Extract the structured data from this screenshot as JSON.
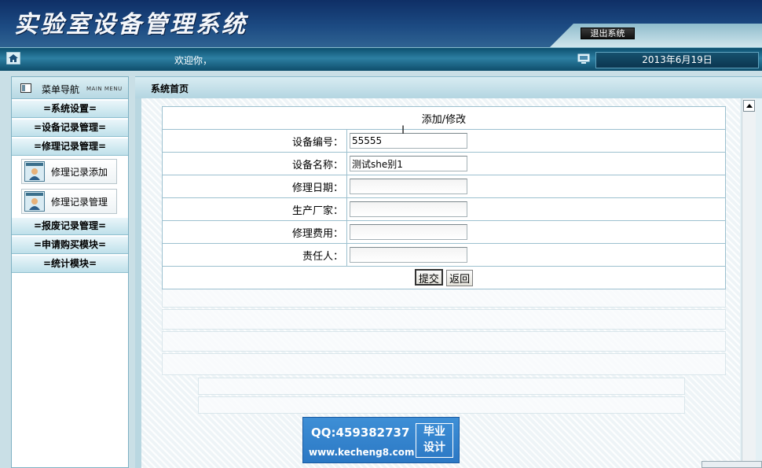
{
  "header": {
    "app_title": "实验室设备管理系统",
    "logout_label": "退出系统"
  },
  "topbar": {
    "welcome": "欢迎你，",
    "date": "2013年6月19日"
  },
  "menu": {
    "title": "菜单导航",
    "title_en": "MAIN MENU",
    "groups": [
      "=系统设置=",
      "=设备记录管理=",
      "=修理记录管理=",
      "=报废记录管理=",
      "=申请购买模块=",
      "=统计模块="
    ],
    "sub_items": [
      "修理记录添加",
      "修理记录管理"
    ]
  },
  "content": {
    "breadcrumb": "系统首页"
  },
  "form": {
    "title": "添加/修改",
    "fields": [
      {
        "label": "设备编号：",
        "value": "55555"
      },
      {
        "label": "设备名称：",
        "value": "测试she别1"
      },
      {
        "label": "修理日期：",
        "value": ""
      },
      {
        "label": "生产厂家：",
        "value": ""
      },
      {
        "label": "修理费用：",
        "value": ""
      },
      {
        "label": "责任人：",
        "value": ""
      }
    ],
    "submit_label": "提交",
    "back_label": "返回"
  },
  "watermark": {
    "qq": "QQ:459382737",
    "url": "www.kecheng8.com",
    "badge_line1": "毕业",
    "badge_line2": "设计"
  }
}
